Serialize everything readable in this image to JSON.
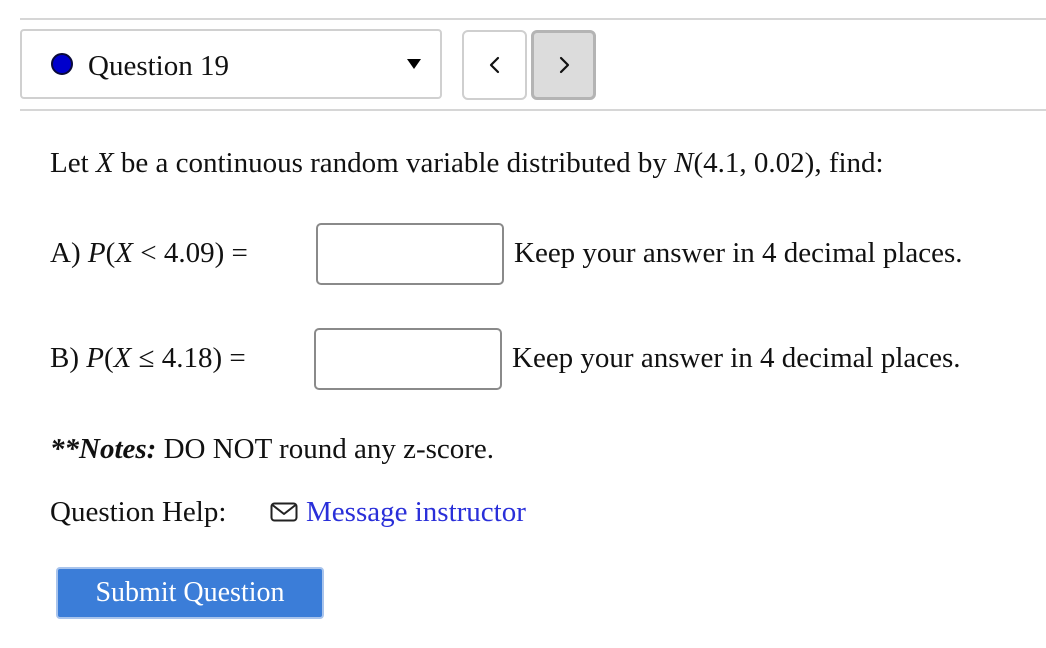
{
  "question_selector": {
    "label": "Question 19",
    "dot_color": "#0000cc"
  },
  "nav": {
    "prev_symbol": "<",
    "next_symbol": ">"
  },
  "prompt": {
    "pre": "Let ",
    "variable": "X",
    "mid": " be a continuous random variable distributed by ",
    "distribution": "N",
    "params": "(4.1, 0.02)",
    "post": ", find:"
  },
  "parts": [
    {
      "label": "A) ",
      "expr_prefix": "P",
      "expr_open": "(",
      "expr_var": "X",
      "expr_rel": " < 4.09) =",
      "value": "",
      "hint": "Keep your answer in 4 decimal places."
    },
    {
      "label": "B) ",
      "expr_prefix": "P",
      "expr_open": "(",
      "expr_var": "X",
      "expr_rel": " ≤ 4.18) =",
      "value": "",
      "hint": "Keep your answer in 4 decimal places."
    }
  ],
  "notes": {
    "label": "**Notes:",
    "text": " DO NOT round any z-score."
  },
  "help": {
    "label": "Question Help:",
    "link_text": "Message instructor",
    "link_icon": "envelope-icon",
    "link_color": "#2a2fd9"
  },
  "submit": {
    "label": "Submit Question",
    "color": "#3b7dd8"
  }
}
